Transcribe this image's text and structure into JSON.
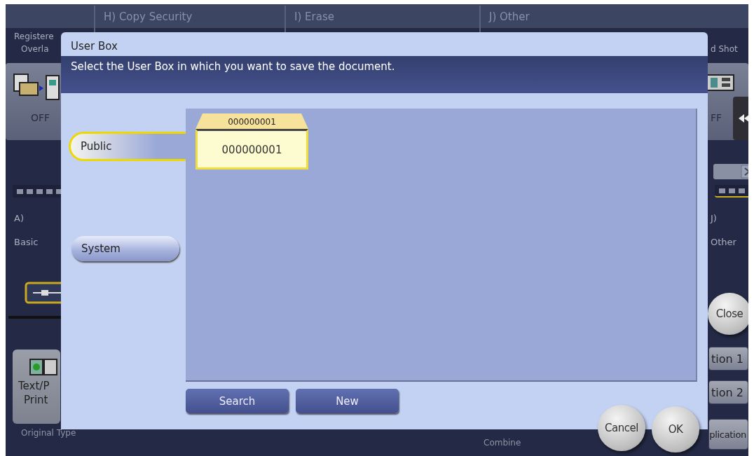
{
  "background": {
    "tabs": [
      {
        "label": "H)  Copy Security"
      },
      {
        "label": "I)  Erase"
      },
      {
        "label": "J)  Other"
      }
    ],
    "left_texts": [
      {
        "kind": "function",
        "text": "Registere"
      },
      {
        "kind": "function",
        "text": "Overla"
      },
      {
        "kind": "state",
        "text": "OFF"
      },
      {
        "kind": "group",
        "text": "A)"
      },
      {
        "kind": "group",
        "text": "Basic"
      }
    ],
    "right_texts": [
      {
        "kind": "function",
        "text": "d Shot"
      },
      {
        "kind": "state",
        "text": "FF"
      },
      {
        "kind": "group",
        "text": "J)"
      },
      {
        "kind": "group",
        "text": "Other"
      }
    ],
    "close_button": "Close",
    "original_type_button": [
      "Text/P",
      "Print"
    ],
    "side_buttons": [
      "tion 1",
      "tion 2",
      "plication"
    ],
    "bottom_labels": [
      {
        "text": "Original Type"
      },
      {
        "text": "Combine"
      }
    ]
  },
  "dialog": {
    "title": "User Box",
    "instruction": "Select the User Box in which you want to save the document.",
    "categories": [
      {
        "label": "Public",
        "selected": true
      },
      {
        "label": "System",
        "selected": false
      }
    ],
    "boxes": [
      {
        "tab": "000000001",
        "name": "000000001",
        "selected": true
      }
    ],
    "buttons": [
      "Search",
      "New"
    ],
    "actions": [
      "Cancel",
      "OK"
    ]
  }
}
